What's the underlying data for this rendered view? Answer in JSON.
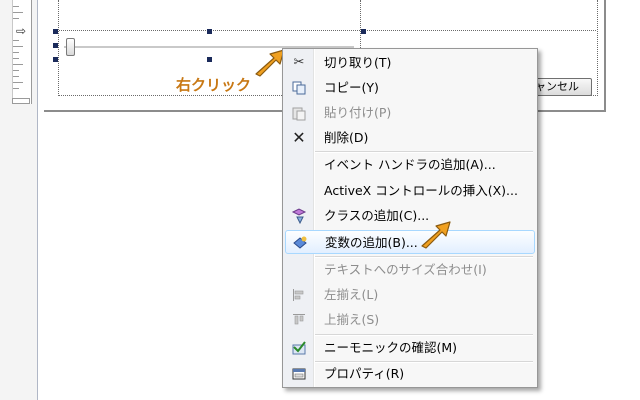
{
  "annotation": {
    "label": "右クリック"
  },
  "dialog": {
    "cancel_button": "ャンセル"
  },
  "context_menu": {
    "items": [
      {
        "label": "切り取り(T)",
        "icon": "cut-icon",
        "enabled": true
      },
      {
        "label": "コピー(Y)",
        "icon": "copy-icon",
        "enabled": true
      },
      {
        "label": "貼り付け(P)",
        "icon": "paste-icon",
        "enabled": false
      },
      {
        "label": "削除(D)",
        "icon": "delete-icon",
        "enabled": true
      },
      {
        "label": "イベント ハンドラの追加(A)...",
        "icon": "",
        "enabled": true
      },
      {
        "label": "ActiveX コントロールの挿入(X)...",
        "icon": "",
        "enabled": true
      },
      {
        "label": "クラスの追加(C)...",
        "icon": "add-class-icon",
        "enabled": true
      },
      {
        "label": "変数の追加(B)...",
        "icon": "add-variable-icon",
        "enabled": true,
        "highlighted": true
      },
      {
        "label": "テキストへのサイズ合わせ(I)",
        "icon": "",
        "enabled": false
      },
      {
        "label": "左揃え(L)",
        "icon": "align-left-icon",
        "enabled": false
      },
      {
        "label": "上揃え(S)",
        "icon": "align-top-icon",
        "enabled": false
      },
      {
        "label": "ニーモニックの確認(M)",
        "icon": "check-mnemonics-icon",
        "enabled": true
      },
      {
        "label": "プロパティ(R)",
        "icon": "properties-icon",
        "enabled": true
      }
    ]
  },
  "colors": {
    "annotation_text": "#c87814",
    "arrow_fill": "#f0a020",
    "highlight_border": "#a8d8ff"
  }
}
